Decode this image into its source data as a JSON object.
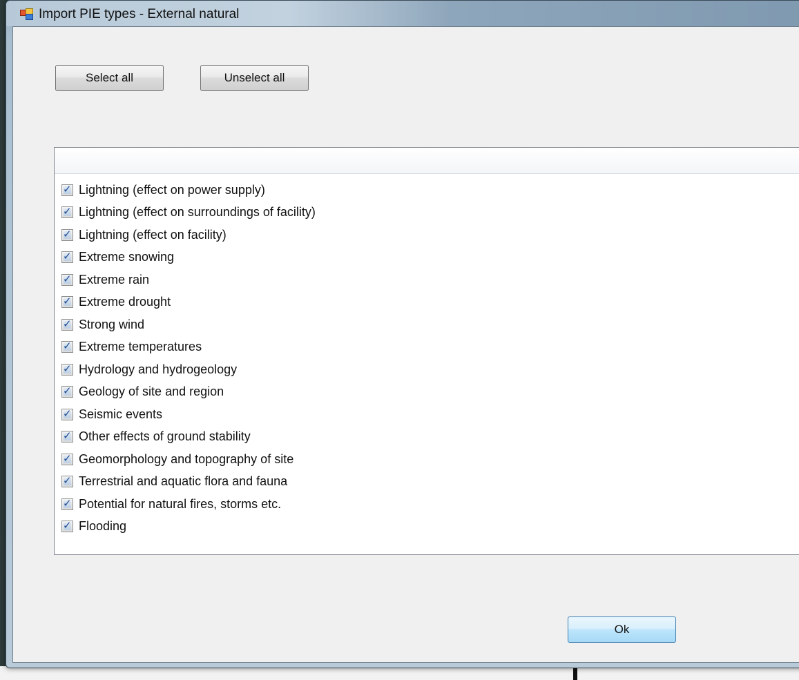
{
  "window": {
    "title": "Import PIE types - External natural"
  },
  "toolbar": {
    "select_all_label": "Select all",
    "unselect_all_label": "Unselect all"
  },
  "list": {
    "items": [
      {
        "label": "Lightning (effect on power supply)",
        "checked": true
      },
      {
        "label": "Lightning (effect on surroundings of facility)",
        "checked": true
      },
      {
        "label": "Lightning (effect on facility)",
        "checked": true
      },
      {
        "label": "Extreme snowing",
        "checked": true
      },
      {
        "label": "Extreme rain",
        "checked": true
      },
      {
        "label": "Extreme drought",
        "checked": true
      },
      {
        "label": "Strong wind",
        "checked": true
      },
      {
        "label": "Extreme temperatures",
        "checked": true
      },
      {
        "label": "Hydrology and hydrogeology",
        "checked": true
      },
      {
        "label": "Geology of site and region",
        "checked": true
      },
      {
        "label": "Seismic events",
        "checked": true
      },
      {
        "label": "Other effects of ground stability",
        "checked": true
      },
      {
        "label": "Geomorphology and topography of site",
        "checked": true
      },
      {
        "label": "Terrestrial and aquatic flora and fauna",
        "checked": true
      },
      {
        "label": "Potential for natural fires, storms etc.",
        "checked": true
      },
      {
        "label": "Flooding",
        "checked": true
      }
    ]
  },
  "footer": {
    "ok_label": "Ok"
  },
  "icons": {
    "app": "app-icon",
    "check": "check-icon"
  }
}
